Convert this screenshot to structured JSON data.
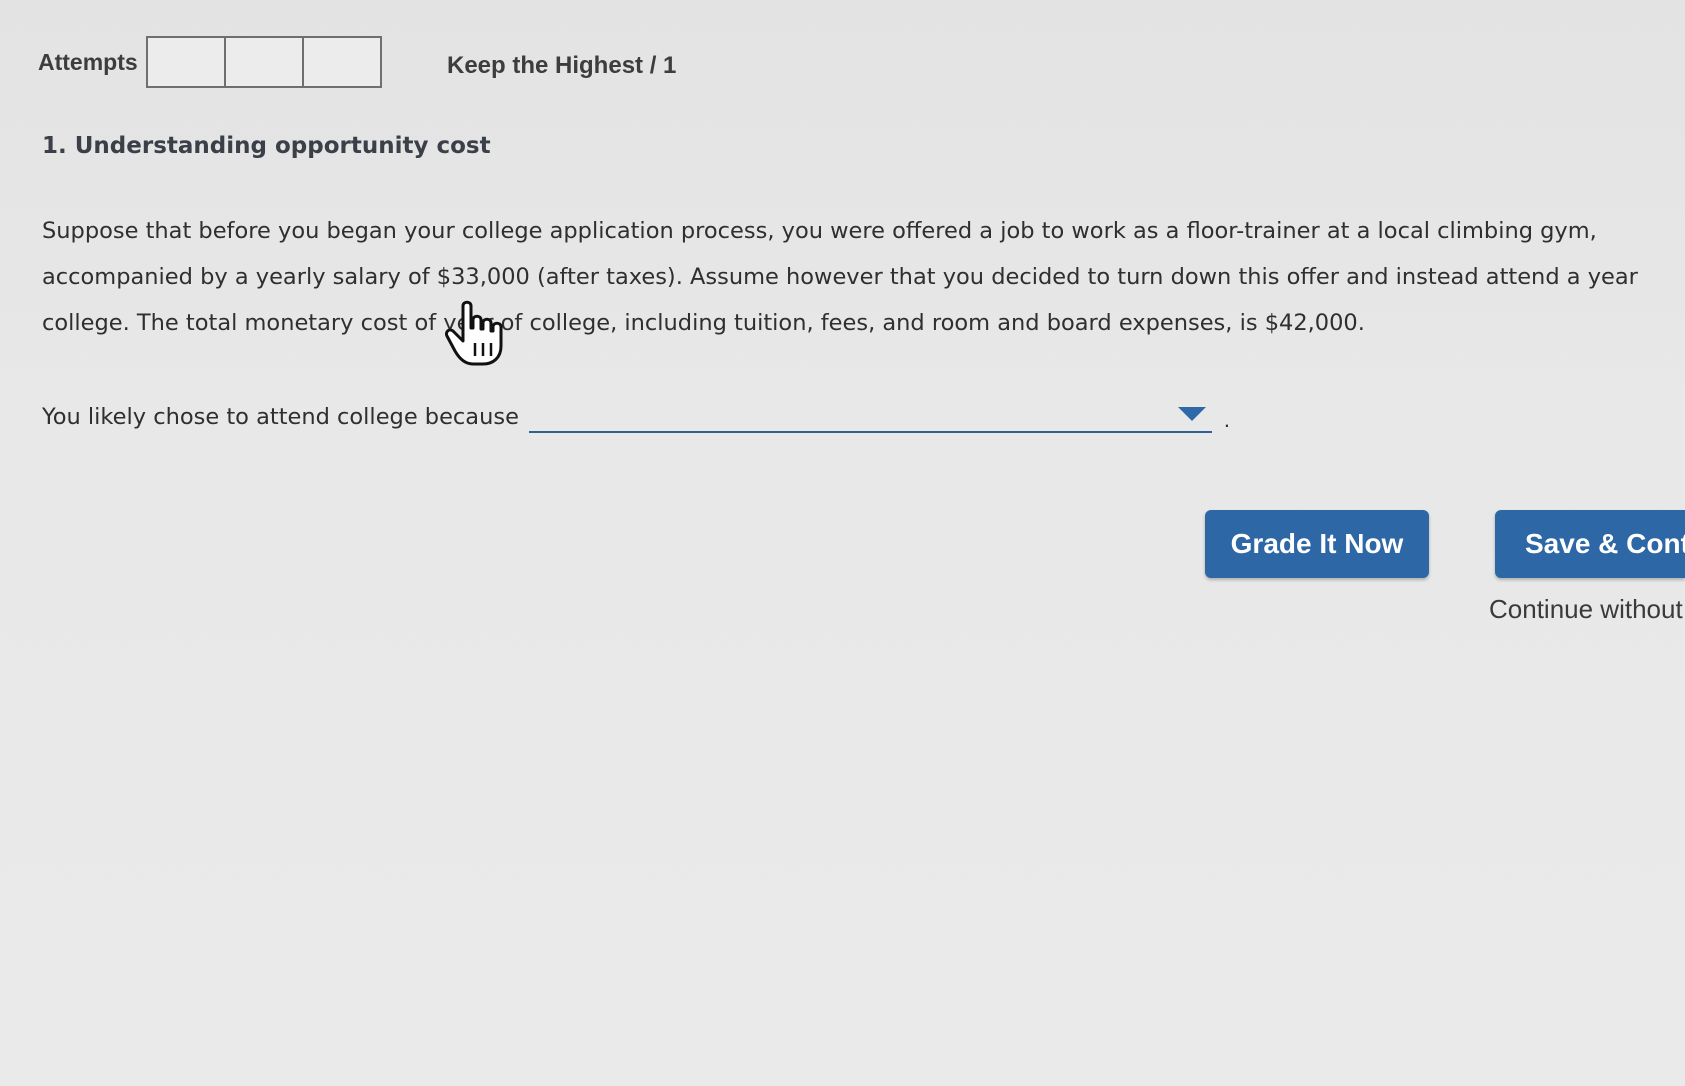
{
  "header": {
    "attempts_label": "Attempts",
    "attempt_boxes": 3,
    "keep_highest": "Keep the Highest / 1"
  },
  "question": {
    "title": "1. Understanding opportunity cost",
    "body_lines": [
      "Suppose that before you began your college application process, you were offered a job to work as a floor-trainer at a local climbing gym,",
      "accompanied by a yearly salary of $33,000 (after taxes). Assume however that you decided to turn down this offer and instead attend a year",
      "college. The total monetary cost of    year of college, including tuition, fees, and room and board expenses, is $42,000."
    ],
    "prompt": "You likely chose to attend college because",
    "dropdown_value": "",
    "prompt_suffix": "."
  },
  "actions": {
    "grade_label": "Grade It Now",
    "save_label": "Save & Conti",
    "continue_label": "Continue without"
  },
  "colors": {
    "button_bg": "#2e67a6",
    "dropdown_line": "#2f5f93"
  },
  "icons": {
    "cursor": "hand-pointer-icon",
    "dropdown": "dropdown-arrow-icon"
  }
}
